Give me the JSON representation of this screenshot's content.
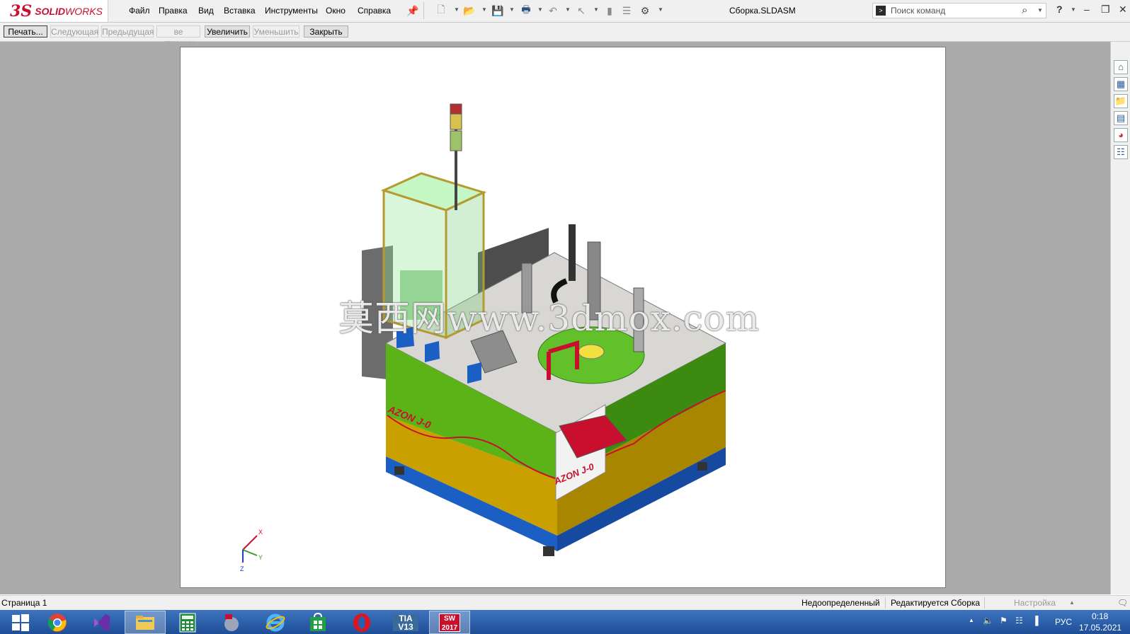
{
  "app": {
    "logo_prefix": "3S",
    "logo_solid": "SOLID",
    "logo_works": "WORKS"
  },
  "menu": {
    "items": [
      "Файл",
      "Правка",
      "Вид",
      "Вставка",
      "Инструменты",
      "Окно",
      "Справка"
    ]
  },
  "document": {
    "title": "Сборка.SLDASM"
  },
  "search": {
    "placeholder": "Поиск команд"
  },
  "preview_toolbar": {
    "print": "Печать...",
    "next": "Следующая",
    "previous": "Предыдущая",
    "pages": "ве страниц",
    "zoom_in": "Увеличить",
    "zoom_out": "Уменьшить",
    "close": "Закрыть"
  },
  "model": {
    "label_front": "AZON J-0",
    "label_side": "AZON J-0",
    "triad": {
      "x": "X",
      "y": "Y",
      "z": "Z"
    }
  },
  "watermark": "莫西网www.3dmox.com",
  "statusbar": {
    "page": "Страница 1",
    "definition": "Недоопределенный",
    "editing": "Редактируется Сборка",
    "customize": "Настройка"
  },
  "taskbar": {
    "apps": [
      "start",
      "chrome",
      "visual-studio",
      "explorer",
      "calculator",
      "sc-app",
      "internet-explorer",
      "store",
      "opera",
      "tia-portal",
      "solidworks"
    ],
    "tia_label": "TIA V13",
    "sw_label": "SW 2017",
    "language": "РУС",
    "time": "0:18",
    "date": "17.05.2021"
  },
  "colors": {
    "brand_red": "#c8102e",
    "canvas_gray": "#ababab",
    "machine_green": "#5bb318",
    "machine_yellow": "#c9a000",
    "machine_blue": "#1c5fc4",
    "machine_top": "#d8d6d2"
  }
}
